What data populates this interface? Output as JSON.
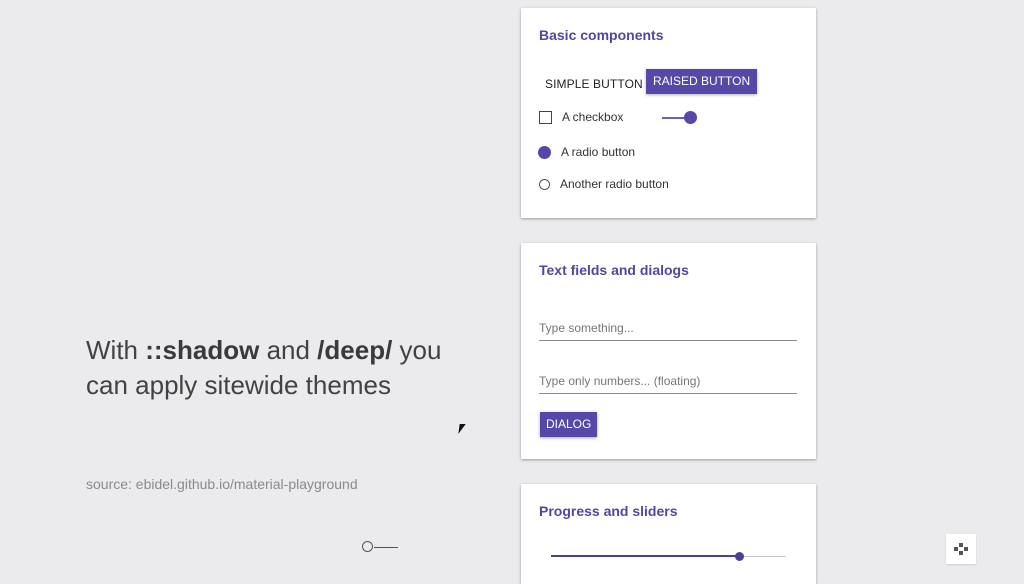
{
  "slide": {
    "headline_pre": "With ",
    "headline_b1": "::shadow",
    "headline_mid": " and ",
    "headline_b2": "/deep/",
    "headline_post": " you can apply sitewide themes",
    "source": "source: ebidel.github.io/material-playground"
  },
  "basic": {
    "title": "Basic components",
    "simple_button": "SIMPLE BUTTON",
    "raised_button": "RAISED BUTTON",
    "checkbox_label": "A checkbox",
    "checkbox_checked": false,
    "toggle_on": true,
    "radio1_label": "A radio button",
    "radio2_label": "Another radio button"
  },
  "textfields": {
    "title": "Text fields and dialogs",
    "field1_placeholder": "Type something...",
    "field2_placeholder": "Type only numbers... (floating)",
    "dialog_button": "DIALOG"
  },
  "progress": {
    "title": "Progress and sliders",
    "slider_value": 0.8
  },
  "colors": {
    "accent": "#5548a8",
    "title": "#5048a0"
  },
  "icons": {
    "corner": "gamepad-icon"
  }
}
